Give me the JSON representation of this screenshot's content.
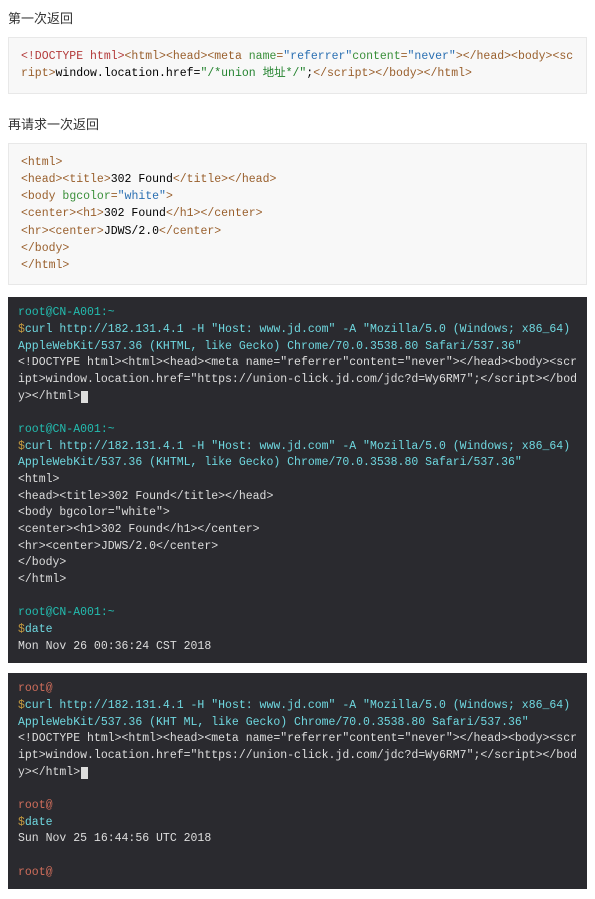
{
  "heading1": "第一次返回",
  "heading2": "再请求一次返回",
  "code1": {
    "doctype_open": "<!DOCTYPE html>",
    "html_head_open": "<html><head><meta ",
    "name_attr": "name",
    "name_val": "\"referrer\"",
    "content_attr": "content",
    "content_val": "\"never\"",
    "head_close_body_open": "></head><body><script>",
    "script_inner": "window.location.href=",
    "url_val": "\"/*union 地址*/\"",
    "script_semi": ";",
    "script_close": "</script></body></html>"
  },
  "code2": {
    "html_tag": "<html>",
    "head_open": "<head>",
    "title_open": "<title>",
    "title_text": "302 Found",
    "title_close": "</title>",
    "head_close": "</head>",
    "body_open": "<body ",
    "bgcolor_attr": "bgcolor",
    "bgcolor_val": "\"white\"",
    "body_open_close": ">",
    "center_open": "<center>",
    "h1_open": "<h1>",
    "h1_text": "302 Found",
    "h1_close": "</h1>",
    "center_close": "</center>",
    "hr_tag": "<hr>",
    "jdws_text": "JDWS/2.0",
    "body_close": "</body>",
    "html_close": "</html>"
  },
  "term1": {
    "prompt1": "root@CN-A001:~",
    "cmd_char": "$",
    "cmd1_a": "curl http://182.131.4.1 -H \"Host: www.jd.com\" -A \"Mozilla/5.0 (Windows; x86_64) AppleWebKit/537.36 (KHTML, like Gecko) Chrome/70.0.3538.80 Safari/537.36\"",
    "out1": "<!DOCTYPE html><html><head><meta name=\"referrer\"content=\"never\"></head><body><script>window.location.href=\"https://union-click.jd.com/jdc?d=Wy6RM7\";</script></body></html>",
    "prompt2": "root@CN-A001:~",
    "cmd2": "curl http://182.131.4.1 -H \"Host: www.jd.com\" -A \"Mozilla/5.0 (Windows; x86_64) AppleWebKit/537.36 (KHTML, like Gecko) Chrome/70.0.3538.80 Safari/537.36\"",
    "out2_l1": "<html>",
    "out2_l2": "<head><title>302 Found</title></head>",
    "out2_l3": "<body bgcolor=\"white\">",
    "out2_l4": "<center><h1>302 Found</h1></center>",
    "out2_l5": "<hr><center>JDWS/2.0</center>",
    "out2_l6": "</body>",
    "out2_l7": "</html>",
    "prompt3": "root@CN-A001:~",
    "date_cmd": "date",
    "date_out": "Mon Nov 26 00:36:24 CST 2018"
  },
  "term2": {
    "prompt1": "root@",
    "cmd1": "curl http://182.131.4.1 -H \"Host: www.jd.com\" -A \"Mozilla/5.0 (Windows; x86_64) AppleWebKit/537.36 (KHT ML, like Gecko) Chrome/70.0.3538.80 Safari/537.36\"",
    "out1": "<!DOCTYPE html><html><head><meta name=\"referrer\"content=\"never\"></head><body><script>window.location.href=\"https://union-click.jd.com/jdc?d=Wy6RM7\";</script></body></html>",
    "prompt2": "root@",
    "date_cmd": "date",
    "date_out": "Sun Nov 25 16:44:56 UTC 2018",
    "prompt3": "root@"
  }
}
